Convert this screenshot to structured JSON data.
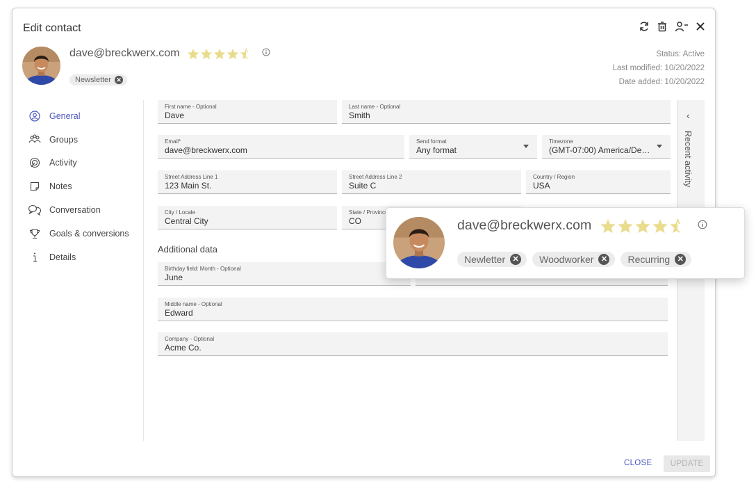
{
  "dialog": {
    "title": "Edit contact",
    "close_label": "CLOSE",
    "update_label": "UPDATE"
  },
  "header_icons": [
    "refresh-icon",
    "trash-icon",
    "remove-user-icon",
    "close-icon"
  ],
  "contact": {
    "email": "dave@breckwerx.com",
    "rating": 4.5,
    "tag": "Newsletter",
    "status": "Status: Active",
    "last_modified": "Last modified: 10/20/2022",
    "date_added": "Date added: 10/20/2022"
  },
  "nav": {
    "items": [
      {
        "label": "General",
        "icon": "user-circle-icon",
        "active": true
      },
      {
        "label": "Groups",
        "icon": "group-icon"
      },
      {
        "label": "Activity",
        "icon": "activity-icon"
      },
      {
        "label": "Notes",
        "icon": "note-icon"
      },
      {
        "label": "Conversation",
        "icon": "conversation-icon"
      },
      {
        "label": "Goals & conversions",
        "icon": "trophy-icon"
      },
      {
        "label": "Details",
        "icon": "info-icon"
      }
    ]
  },
  "fields": {
    "first_name": {
      "label": "First name - Optional",
      "value": "Dave"
    },
    "last_name": {
      "label": "Last name - Optional",
      "value": "Smith"
    },
    "email": {
      "label": "Email*",
      "value": "dave@breckwerx.com"
    },
    "send_format": {
      "label": "Send format",
      "value": "Any format"
    },
    "timezone": {
      "label": "Timezone",
      "value": "(GMT-07:00) America/Denver"
    },
    "street1": {
      "label": "Street Address Line 1",
      "value": "123 Main St."
    },
    "street2": {
      "label": "Street Address Line 2",
      "value": "Suite C"
    },
    "country": {
      "label": "Country / Region",
      "value": "USA"
    },
    "city": {
      "label": "City / Locale",
      "value": "Central City"
    },
    "state": {
      "label": "State / Province",
      "value": "CO"
    },
    "birthday": {
      "label": "Birthday field: Month - Optional",
      "value": "June"
    },
    "middle_name": {
      "label": "Middle name - Optional",
      "value": "Edward"
    },
    "company": {
      "label": "Company - Optional",
      "value": "Acme Co."
    }
  },
  "additional_data_title": "Additional data",
  "side_panel": {
    "label": "Recent activity"
  },
  "popup": {
    "email": "dave@breckwerx.com",
    "rating": 4.5,
    "tags": [
      "Newletter",
      "Woodworker",
      "Recurring"
    ]
  },
  "colors": {
    "accent": "#4d57c4",
    "star": "#e9dc8d",
    "field_bg": "#f3f3f3"
  }
}
